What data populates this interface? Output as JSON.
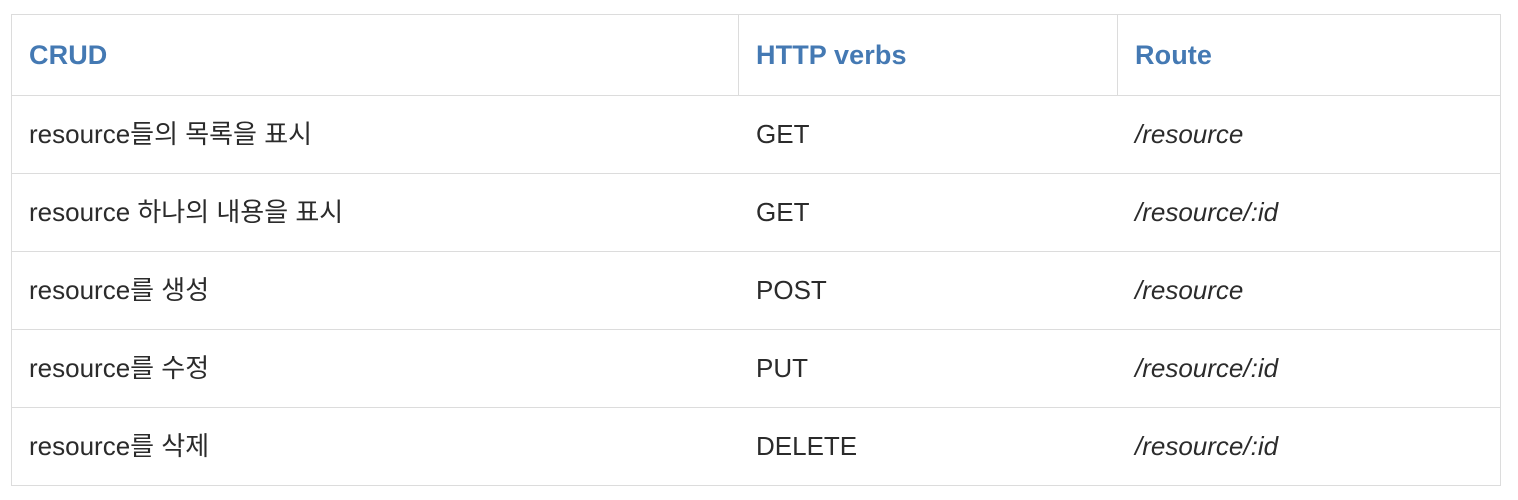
{
  "table": {
    "columns": [
      {
        "key": "crud",
        "label": "CRUD"
      },
      {
        "key": "verb",
        "label": "HTTP verbs"
      },
      {
        "key": "route",
        "label": "Route"
      }
    ],
    "rows": [
      {
        "crud": "resource들의 목록을 표시",
        "verb": "GET",
        "route": "/resource"
      },
      {
        "crud": "resource 하나의 내용을 표시",
        "verb": "GET",
        "route": "/resource/:id"
      },
      {
        "crud": "resource를 생성",
        "verb": "POST",
        "route": "/resource"
      },
      {
        "crud": "resource를 수정",
        "verb": "PUT",
        "route": "/resource/:id"
      },
      {
        "crud": "resource를 삭제",
        "verb": "DELETE",
        "route": "/resource/:id"
      }
    ]
  },
  "colors": {
    "header_text": "#4479b3",
    "body_text": "#2b2b2b",
    "border": "#dcdcdc",
    "background": "#ffffff"
  }
}
